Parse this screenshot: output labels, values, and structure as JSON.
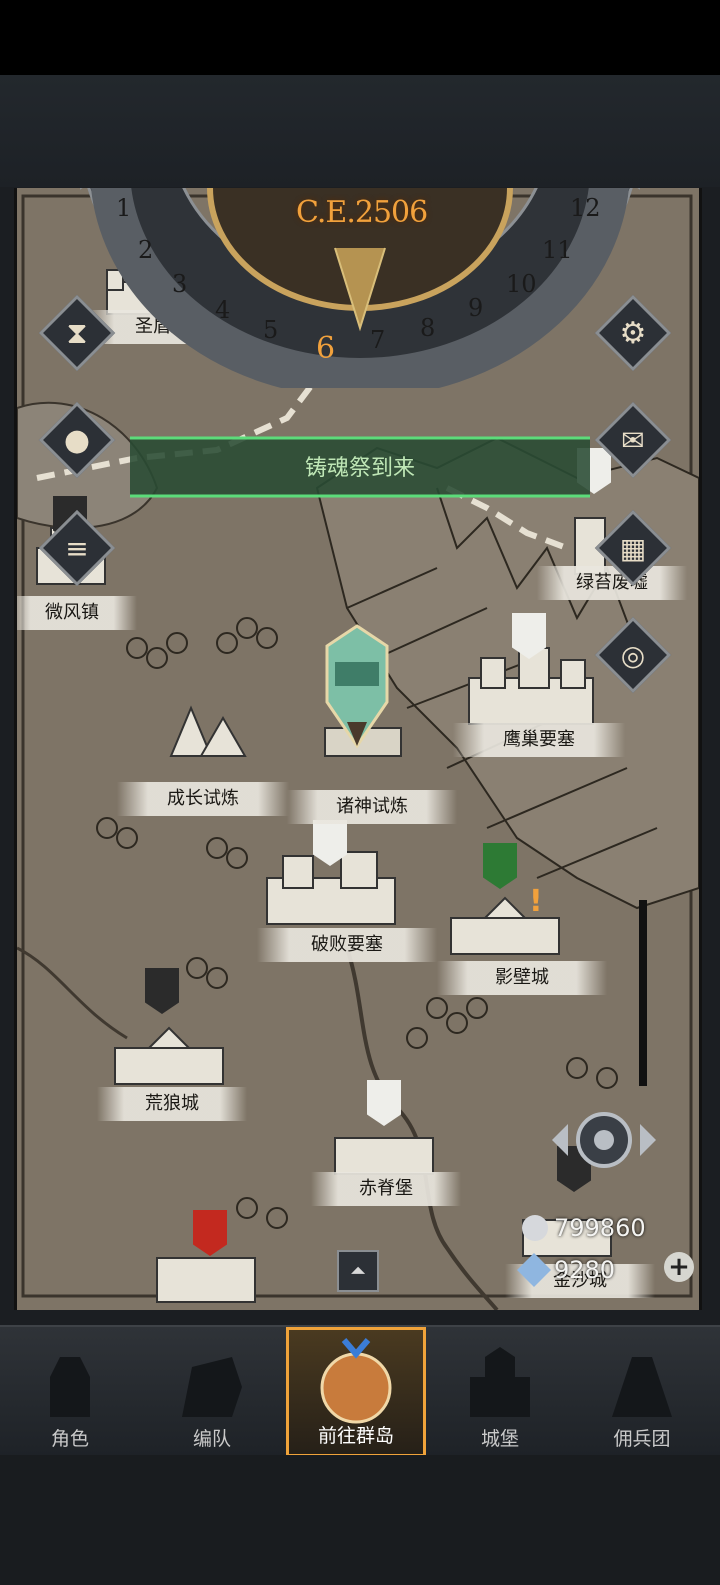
{
  "header": {
    "era": "C.E.2506"
  },
  "dial": {
    "months": [
      "1",
      "2",
      "3",
      "4",
      "5",
      "6",
      "7",
      "8",
      "9",
      "10",
      "11",
      "12"
    ],
    "current": "6"
  },
  "event_banner": {
    "text": "铸魂祭到来"
  },
  "locations": {
    "shengdun": "圣盾堡",
    "weifeng": "微风镇",
    "lvtai": "绿苔废墟",
    "yingchao": "鹰巢要塞",
    "chengzhang": "成长试炼",
    "zhushen": "诸神试炼",
    "pobai": "破败要塞",
    "yingbi": "影壁城",
    "huanglang": "荒狼城",
    "chiji": "赤脊堡",
    "jinsha": "金沙城"
  },
  "currency": {
    "silver": "799860",
    "gems": "9280"
  },
  "nav": [
    {
      "label": "角色",
      "icon": "knight-icon"
    },
    {
      "label": "编队",
      "icon": "helmet-icon"
    },
    {
      "label": "前往群岛",
      "icon": "globe-icon"
    },
    {
      "label": "城堡",
      "icon": "castle-icon"
    },
    {
      "label": "佣兵团",
      "icon": "mercenary-icon"
    }
  ],
  "colors": {
    "accent": "#f0a33a",
    "banner": "#3fae5c",
    "map": "#7d7365"
  }
}
